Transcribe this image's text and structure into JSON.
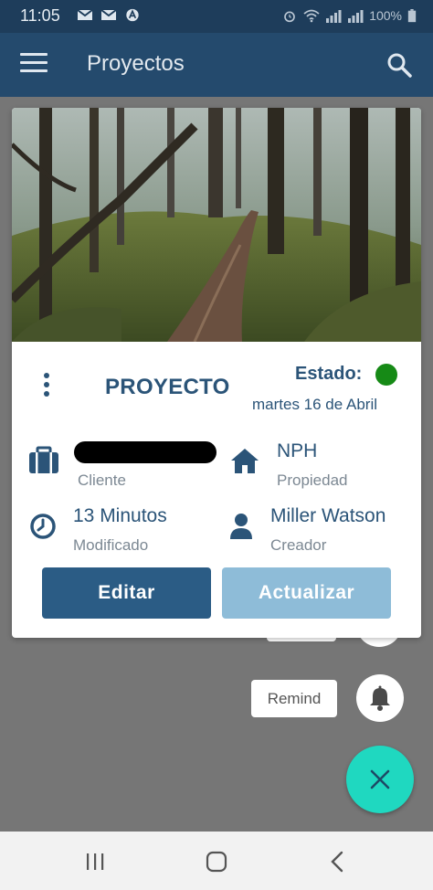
{
  "status_bar": {
    "time": "11:05",
    "battery": "100%",
    "left_icons": [
      "mail-icon",
      "mail-icon",
      "a-icon"
    ],
    "right_icons": [
      "alarm-icon",
      "wifi-icon",
      "signal-icon",
      "signal-icon",
      "battery-icon"
    ]
  },
  "app_bar": {
    "title": "Proyectos",
    "menu_icon": "menu-icon",
    "search_icon": "search-icon"
  },
  "card": {
    "title": "PROYECTO",
    "estado_label": "Estado:",
    "estado_color": "#168a16",
    "date": "martes 16 de Abril",
    "cliente_caption": "Cliente",
    "propiedad_value": "NPH",
    "propiedad_caption": "Propiedad",
    "modificado_value": "13 Minutos",
    "modificado_caption": "Modificado",
    "creador_value": "Miller Watson",
    "creador_caption": "Creador",
    "edit_button": "Editar",
    "update_button": "Actualizar"
  },
  "fab_menu": {
    "remind_label": "Remind",
    "remind_icon": "bell-icon",
    "close_icon": "close-icon"
  },
  "colors": {
    "app_bar": "#244a6d",
    "primary_text": "#2b5478",
    "edit_button": "#2b5c85",
    "update_button": "#8ebcd8",
    "fab": "#1fd8c0"
  },
  "nav_bar": {
    "icons": [
      "recent-apps-icon",
      "home-icon",
      "back-icon"
    ]
  }
}
